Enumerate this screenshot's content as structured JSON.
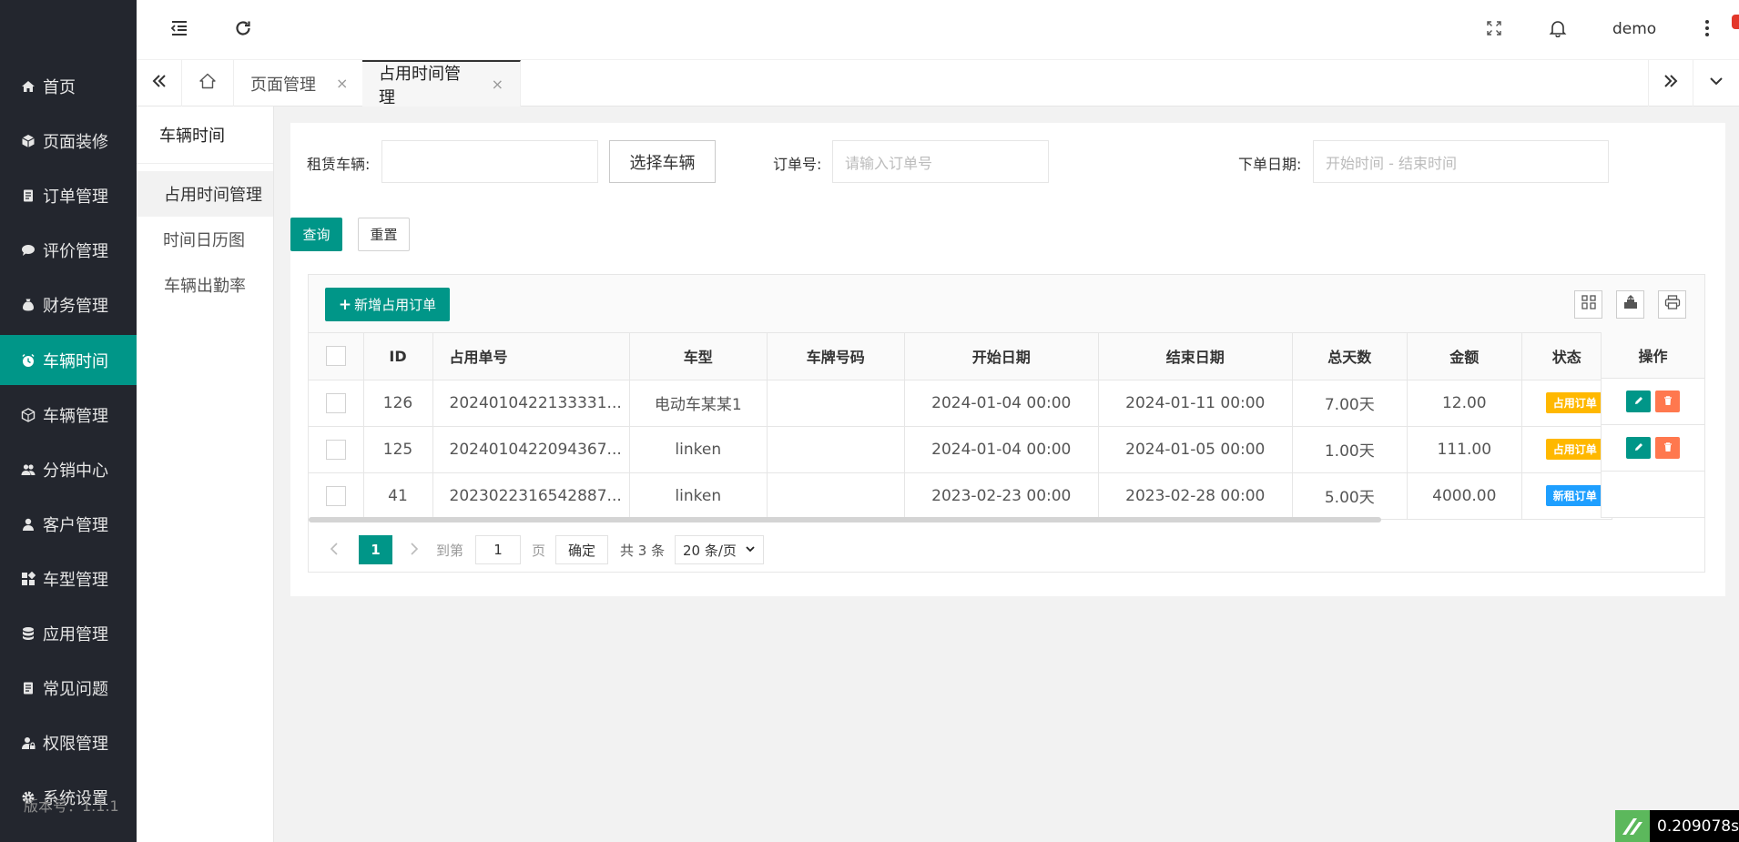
{
  "sidebar": {
    "items": [
      {
        "label": "首页",
        "icon": "home-icon"
      },
      {
        "label": "页面装修",
        "icon": "cube-icon"
      },
      {
        "label": "订单管理",
        "icon": "file-icon"
      },
      {
        "label": "评价管理",
        "icon": "comment-icon"
      },
      {
        "label": "财务管理",
        "icon": "money-bag-icon"
      },
      {
        "label": "车辆时间",
        "icon": "clock-icon"
      },
      {
        "label": "车辆管理",
        "icon": "cube-icon"
      },
      {
        "label": "分销中心",
        "icon": "users-icon"
      },
      {
        "label": "客户管理",
        "icon": "user-icon"
      },
      {
        "label": "车型管理",
        "icon": "grid-icon"
      },
      {
        "label": "应用管理",
        "icon": "database-icon"
      },
      {
        "label": "常见问题",
        "icon": "file-icon"
      },
      {
        "label": "权限管理",
        "icon": "user-lock-icon"
      },
      {
        "label": "系统设置",
        "icon": "gear-icon"
      }
    ],
    "active_index": 5,
    "version": "版本号：1.1.1"
  },
  "header": {
    "user": "demo"
  },
  "tabs": {
    "items": [
      {
        "label": "页面管理"
      },
      {
        "label": "占用时间管理"
      }
    ],
    "close_glyph": "×"
  },
  "subnav": {
    "title": "车辆时间",
    "items": [
      "占用时间管理",
      "时间日历图",
      "车辆出勤率"
    ],
    "active_index": 0
  },
  "filters": {
    "vehicle_label": "租赁车辆:",
    "vehicle_value": "",
    "select_vehicle_button": "选择车辆",
    "order_label": "订单号:",
    "order_placeholder": "请输入订单号",
    "date_label": "下单日期:",
    "date_placeholder": "开始时间 - 结束时间",
    "search_button": "查询",
    "reset_button": "重置"
  },
  "toolbar": {
    "add_button": "新增占用订单"
  },
  "table": {
    "columns": [
      "ID",
      "占用单号",
      "车型",
      "车牌号码",
      "开始日期",
      "结束日期",
      "总天数",
      "金额",
      "状态",
      "操作"
    ],
    "rows": [
      {
        "id": "126",
        "order_no": "2024010422133331...",
        "model": "电动车某某1",
        "plate": "",
        "start": "2024-01-04 00:00",
        "end": "2024-01-11 00:00",
        "days": "7.00天",
        "amount": "12.00",
        "status": "占用订单",
        "status_color": "#ffb800",
        "has_actions": true
      },
      {
        "id": "125",
        "order_no": "2024010422094367...",
        "model": "linken",
        "plate": "",
        "start": "2024-01-04 00:00",
        "end": "2024-01-05 00:00",
        "days": "1.00天",
        "amount": "111.00",
        "status": "占用订单",
        "status_color": "#ffb800",
        "has_actions": true
      },
      {
        "id": "41",
        "order_no": "2023022316542887...",
        "model": "linken",
        "plate": "",
        "start": "2023-02-23 00:00",
        "end": "2023-02-28 00:00",
        "days": "5.00天",
        "amount": "4000.00",
        "status": "新租订单",
        "status_color": "#1e9fff",
        "has_actions": false
      }
    ]
  },
  "pager": {
    "current": "1",
    "goto_label": "到第",
    "goto_value": "1",
    "page_label": "页",
    "confirm": "确定",
    "total": "共 3 条",
    "page_size": "20 条/页"
  },
  "timer": "0.209078s",
  "colors": {
    "accent": "#009688",
    "sidebar_bg": "#23262e",
    "danger": "#ff5722",
    "warn": "#ffb800",
    "info": "#1e9fff"
  }
}
